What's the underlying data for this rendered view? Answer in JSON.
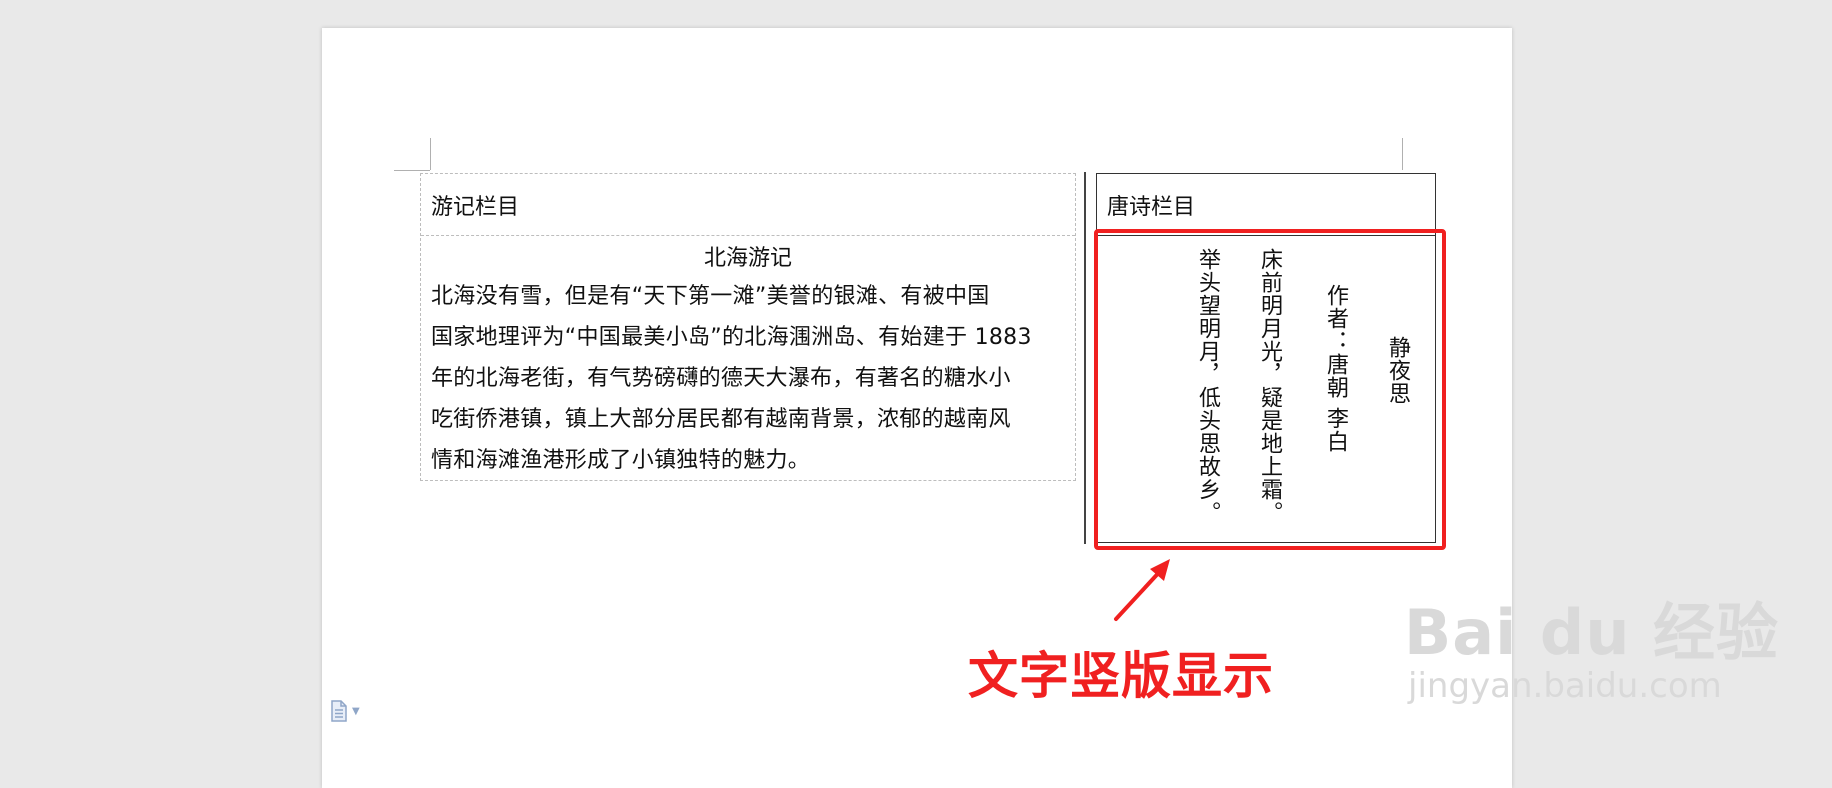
{
  "travel_section": {
    "label": "游记栏目",
    "article_title": "北海游记",
    "article_lines": [
      "北海没有雪，但是有“天下第一滩”美誉的银滩、有被中国",
      "国家地理评为“中国最美小岛”的北海涠洲岛、有始建于 1883",
      "年的北海老街，有气势磅礴的德天大瀑布，有著名的糖水小",
      "吃街侨港镇，镇上大部分居民都有越南背景，浓郁的越南风",
      "情和海滩渔港形成了小镇独特的魅力。"
    ]
  },
  "poem_section": {
    "label": "唐诗栏目",
    "title": "静夜思",
    "author": "作者：唐朝  李白",
    "line1": "床前明月光，疑是地上霜。",
    "line2": "举头望明月，低头思故乡。"
  },
  "annotation": {
    "text": "文字竖版显示",
    "color": "#f02020"
  },
  "watermark": {
    "brand": "Bai du 经验",
    "url": "jingyan.baidu.com"
  }
}
